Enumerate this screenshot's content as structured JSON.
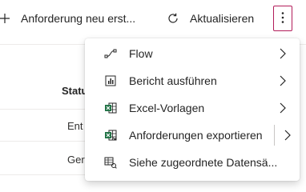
{
  "commandbar": {
    "new_request_label": "Anforderung neu erst...",
    "refresh_label": "Aktualisieren"
  },
  "grid": {
    "status_header": "Statu",
    "rows": [
      "Ent",
      "Ger"
    ]
  },
  "menu": {
    "items": [
      {
        "label": "Flow",
        "icon": "flow-icon",
        "has_submenu": true
      },
      {
        "label": "Bericht ausführen",
        "icon": "report-icon",
        "has_submenu": true
      },
      {
        "label": "Excel-Vorlagen",
        "icon": "excel-icon",
        "has_submenu": true
      },
      {
        "label": "Anforderungen exportieren",
        "icon": "excel-export-icon",
        "has_submenu": true
      },
      {
        "label": "Siehe zugeordnete Datensä...",
        "icon": "related-records-icon",
        "has_submenu": false
      }
    ]
  },
  "colors": {
    "accent_border": "#b21c5a",
    "excel_green": "#217346"
  }
}
